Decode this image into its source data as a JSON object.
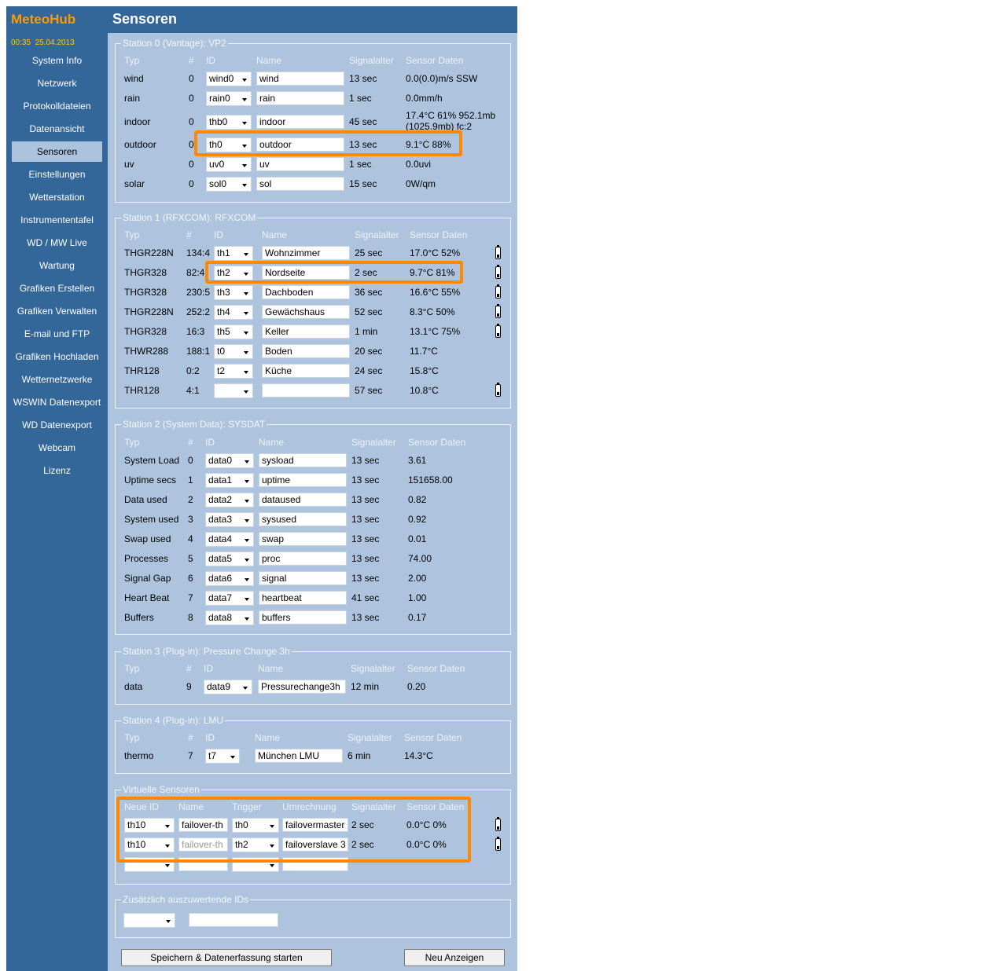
{
  "app": {
    "logo": "MeteoHub",
    "time": "00:35",
    "date": "25.04.2013",
    "page_title": "Sensoren"
  },
  "nav": [
    "System Info",
    "Netzwerk",
    "Protokolldateien",
    "Datenansicht",
    "Sensoren",
    "Einstellungen",
    "Wetterstation",
    "Instrumententafel",
    "WD / MW Live",
    "Wartung",
    "Grafiken Erstellen",
    "Grafiken Verwalten",
    "E-mail und FTP",
    "Grafiken Hochladen",
    "Wetternetzwerke",
    "WSWIN Datenexport",
    "WD Datenexport",
    "Webcam",
    "Lizenz"
  ],
  "nav_active": "Sensoren",
  "headers": {
    "typ": "Typ",
    "num": "#",
    "id": "ID",
    "name": "Name",
    "sig": "Signalalter",
    "data": "Sensor Daten"
  },
  "stations": [
    {
      "legend": "Station 0 (Vantage): VP2",
      "rows": [
        {
          "typ": "wind",
          "num": "0",
          "id": "wind0",
          "name": "wind",
          "sig": "13 sec",
          "data": "0.0(0.0)m/s SSW"
        },
        {
          "typ": "rain",
          "num": "0",
          "id": "rain0",
          "name": "rain",
          "sig": "1 sec",
          "data": "0.0mm/h"
        },
        {
          "typ": "indoor",
          "num": "0",
          "id": "thb0",
          "name": "indoor",
          "sig": "45 sec",
          "data": "17.4°C 61% 952.1mb",
          "data2": "(1025.9mb) fc:2"
        },
        {
          "typ": "outdoor",
          "num": "0",
          "id": "th0",
          "name": "outdoor",
          "sig": "13 sec",
          "data": "9.1°C 88%"
        },
        {
          "typ": "uv",
          "num": "0",
          "id": "uv0",
          "name": "uv",
          "sig": "1 sec",
          "data": "0.0uvi"
        },
        {
          "typ": "solar",
          "num": "0",
          "id": "sol0",
          "name": "sol",
          "sig": "15 sec",
          "data": "0W/qm"
        }
      ]
    },
    {
      "legend": "Station 1 (RFXCOM): RFXCOM",
      "rows": [
        {
          "typ": "THGR228N",
          "num": "134:4",
          "id": "th1",
          "name": "Wohnzimmer",
          "sig": "25 sec",
          "data": "17.0°C 52%",
          "batt": true
        },
        {
          "typ": "THGR328",
          "num": "82:4",
          "id": "th2",
          "name": "Nordseite",
          "sig": "2 sec",
          "data": "9.7°C 81%",
          "batt": true
        },
        {
          "typ": "THGR328",
          "num": "230:5",
          "id": "th3",
          "name": "Dachboden",
          "sig": "36 sec",
          "data": "16.6°C 55%",
          "batt": true
        },
        {
          "typ": "THGR228N",
          "num": "252:2",
          "id": "th4",
          "name": "Gewächshaus",
          "sig": "52 sec",
          "data": "8.3°C 50%",
          "batt": true
        },
        {
          "typ": "THGR328",
          "num": "16:3",
          "id": "th5",
          "name": "Keller",
          "sig": "1 min",
          "data": "13.1°C 75%",
          "batt": true
        },
        {
          "typ": "THWR288",
          "num": "188:1",
          "id": "t0",
          "name": "Boden",
          "sig": "20 sec",
          "data": "11.7°C",
          "batt": false
        },
        {
          "typ": "THR128",
          "num": "0:2",
          "id": "t2",
          "name": "Küche",
          "sig": "24 sec",
          "data": "15.8°C",
          "batt": false
        },
        {
          "typ": "THR128",
          "num": "4:1",
          "id": "",
          "name": "",
          "sig": "57 sec",
          "data": "10.8°C",
          "batt": true
        }
      ]
    },
    {
      "legend": "Station 2 (System Data): SYSDAT",
      "rows": [
        {
          "typ": "System Load",
          "num": "0",
          "id": "data0",
          "name": "sysload",
          "sig": "13 sec",
          "data": "3.61"
        },
        {
          "typ": "Uptime secs",
          "num": "1",
          "id": "data1",
          "name": "uptime",
          "sig": "13 sec",
          "data": "151658.00"
        },
        {
          "typ": "Data used",
          "num": "2",
          "id": "data2",
          "name": "dataused",
          "sig": "13 sec",
          "data": "0.82"
        },
        {
          "typ": "System used",
          "num": "3",
          "id": "data3",
          "name": "sysused",
          "sig": "13 sec",
          "data": "0.92"
        },
        {
          "typ": "Swap used",
          "num": "4",
          "id": "data4",
          "name": "swap",
          "sig": "13 sec",
          "data": "0.01"
        },
        {
          "typ": "Processes",
          "num": "5",
          "id": "data5",
          "name": "proc",
          "sig": "13 sec",
          "data": "74.00"
        },
        {
          "typ": "Signal Gap",
          "num": "6",
          "id": "data6",
          "name": "signal",
          "sig": "13 sec",
          "data": "2.00"
        },
        {
          "typ": "Heart Beat",
          "num": "7",
          "id": "data7",
          "name": "heartbeat",
          "sig": "41 sec",
          "data": "1.00"
        },
        {
          "typ": "Buffers",
          "num": "8",
          "id": "data8",
          "name": "buffers",
          "sig": "13 sec",
          "data": "0.17"
        }
      ]
    },
    {
      "legend": "Station 3 (Plug-in): Pressure Change 3h",
      "rows": [
        {
          "typ": "data",
          "num": "9",
          "id": "data9",
          "name": "Pressurechange3h",
          "sig": "12 min",
          "data": "0.20"
        }
      ]
    },
    {
      "legend": "Station 4 (Plug-in): LMU",
      "rows": [
        {
          "typ": "thermo",
          "num": "7",
          "id": "t7",
          "name": "München LMU",
          "sig": "6 min",
          "data": "14.3°C"
        }
      ]
    }
  ],
  "virtual": {
    "legend": "Virtuelle Sensoren",
    "headers": {
      "neue_id": "Neue ID",
      "name": "Name",
      "trigger": "Trigger",
      "umrechnung": "Umrechnung",
      "sig": "Signalalter",
      "data": "Sensor Daten"
    },
    "rows": [
      {
        "neue_id": "th10",
        "name": "failover-th",
        "name_placeholder": false,
        "trigger": "th0",
        "umrechnung": "failovermaster",
        "sig": "2 sec",
        "data": "0.0°C 0%"
      },
      {
        "neue_id": "th10",
        "name": "failover-th",
        "name_placeholder": true,
        "trigger": "th2",
        "umrechnung": "failoverslave 3",
        "sig": "2 sec",
        "data": "0.0°C 0%"
      }
    ]
  },
  "extra": {
    "legend": "Zusätzlich auszuwertende IDs"
  },
  "buttons": {
    "save": "Speichern & Datenerfassung starten",
    "show": "Neu Anzeigen"
  },
  "colors": {
    "sidebar": "#336699",
    "content": "#aec4de",
    "logo": "#ff9900",
    "highlight": "#ff8800"
  }
}
